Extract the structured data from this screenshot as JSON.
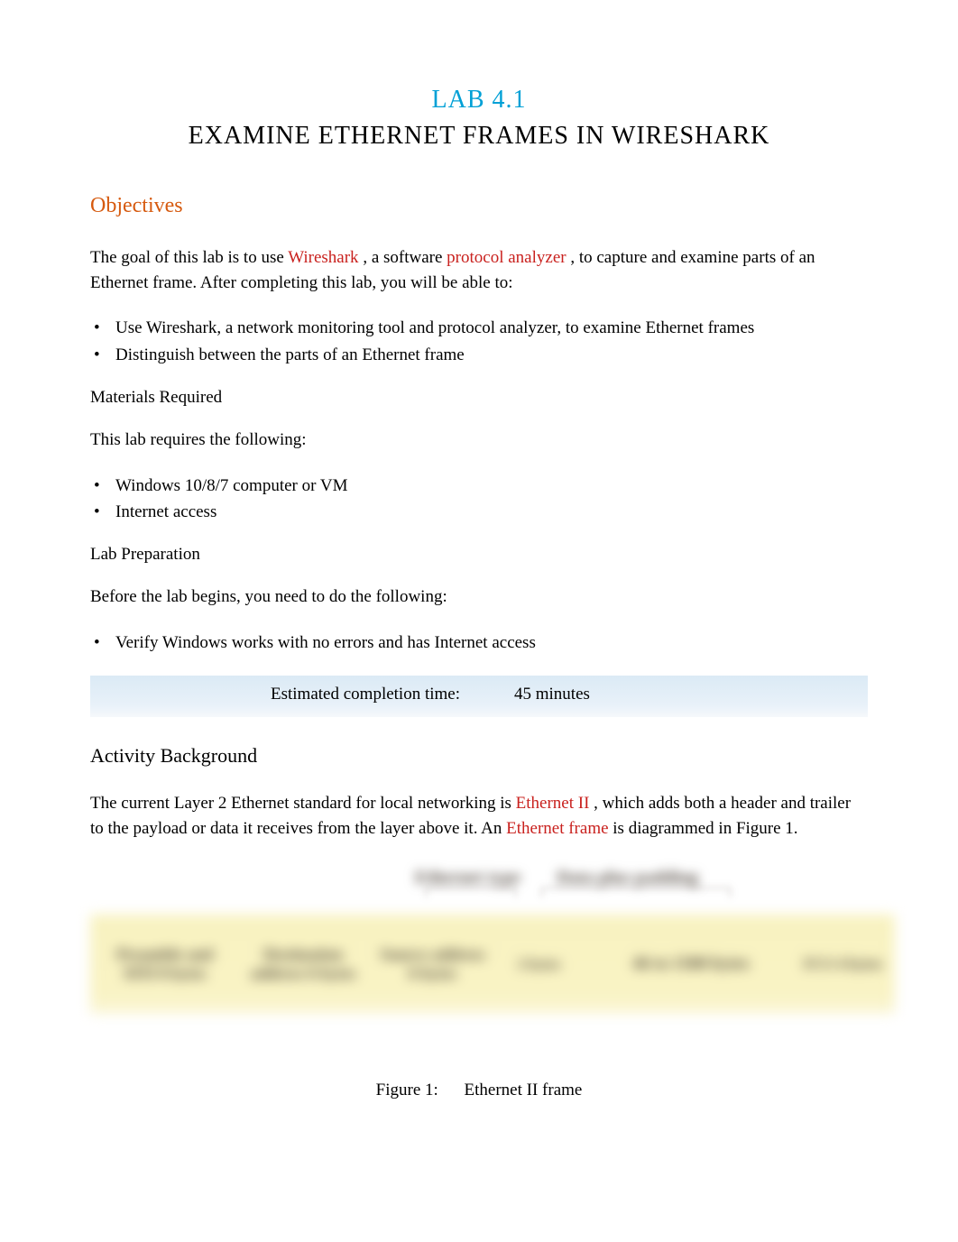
{
  "header": {
    "lab_number": "LAB 4.1",
    "title": "EXAMINE ETHERNET FRAMES IN WIRESHARK"
  },
  "objectives": {
    "heading": "Objectives",
    "intro_1": "The goal of this lab is to use ",
    "term_wireshark": "Wireshark",
    "intro_2": ", a software ",
    "term_protocol_analyzer": "protocol analyzer",
    "intro_3": ", to capture and examine parts of an Ethernet frame. After completing this lab, you will be able to:",
    "bullets": [
      "Use Wireshark, a network monitoring tool and protocol analyzer, to examine Ethernet frames",
      "Distinguish between the parts of an Ethernet frame"
    ]
  },
  "materials": {
    "heading": "Materials Required",
    "intro": "This lab requires the following:",
    "bullets": [
      "Windows 10/8/7 computer or VM",
      "Internet access"
    ]
  },
  "prep": {
    "heading": "Lab Preparation",
    "intro": "Before the lab begins, you need to do the following:",
    "bullets": [
      "Verify Windows works with no errors and has Internet access"
    ]
  },
  "time": {
    "label": "Estimated completion time:",
    "value": "45 minutes"
  },
  "activity": {
    "heading": "Activity Background",
    "p1_a": "The current Layer 2 Ethernet standard for local networking is ",
    "term_eth2": "Ethernet II",
    "p1_b": ", which adds both a header and trailer to the payload or data it receives from the layer above it. An ",
    "term_eth_frame": "Ethernet frame",
    "p1_c": " is diagrammed in Figure 1."
  },
  "diagram": {
    "top_label_1": "Ethernet type",
    "top_label_2": "Data plus padding",
    "cells": {
      "c1": "Preamble and SFD 8 bytes",
      "c2": "Destination address 6 bytes",
      "c3": "Source address 6 bytes",
      "c4": "2 bytes",
      "c5": "46 to 1500 bytes",
      "c6": "FCS 4 bytes"
    }
  },
  "figure": {
    "number": "Figure 1:",
    "caption": "Ethernet II frame"
  }
}
